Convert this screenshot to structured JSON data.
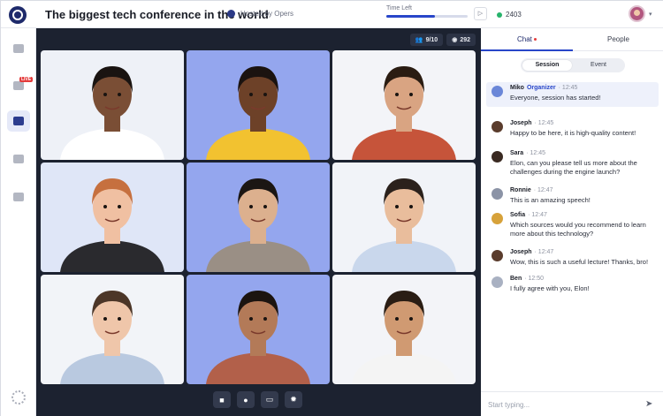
{
  "header": {
    "title": "The biggest tech conference in the world",
    "hosted_by": "Hosted by Opers",
    "time_left_label": "Time Left",
    "time_left_fraction": 0.6,
    "online_count": "2403"
  },
  "sidebar": {
    "items": [
      {
        "icon": "home-icon"
      },
      {
        "icon": "live-video-icon",
        "badge": "LIVE"
      },
      {
        "icon": "people-group-icon",
        "active": true
      },
      {
        "icon": "handshake-icon"
      },
      {
        "icon": "booth-icon"
      }
    ]
  },
  "stage": {
    "participants_count": "9/10",
    "viewers_count": "292",
    "tiles": [
      {
        "bg": "#eef1f7",
        "skin": "#7a4e35",
        "hair": "#1a1411",
        "shirt": "#ffffff"
      },
      {
        "bg": "#94a6ee",
        "skin": "#6d4128",
        "hair": "#1b1310",
        "shirt": "#f2c230"
      },
      {
        "bg": "#f3f4f8",
        "skin": "#d9a482",
        "hair": "#2a1c12",
        "shirt": "#c6543a"
      },
      {
        "bg": "#dfe6f7",
        "skin": "#f0c0a2",
        "hair": "#c6703f",
        "shirt": "#2a2a2e"
      },
      {
        "bg": "#94a6ee",
        "skin": "#dcb08e",
        "hair": "#1b1613",
        "shirt": "#9a8f85"
      },
      {
        "bg": "#f1f3f8",
        "skin": "#e9bd9c",
        "hair": "#2b211c",
        "shirt": "#c9d7ec"
      },
      {
        "bg": "#f2f4f8",
        "skin": "#efc6aa",
        "hair": "#4c3628",
        "shirt": "#b9c9e0"
      },
      {
        "bg": "#94a6ee",
        "skin": "#b37a58",
        "hair": "#1c1410",
        "shirt": "#b2604a"
      },
      {
        "bg": "#f3f4f8",
        "skin": "#d09a72",
        "hair": "#2a1d14",
        "shirt": "#f4f4f4"
      }
    ]
  },
  "chat": {
    "tab_chat": "Chat",
    "tab_people": "People",
    "seg_session": "Session",
    "seg_event": "Event",
    "input_placeholder": "Start typing...",
    "messages": [
      {
        "name": "Miko",
        "role": "Organizer",
        "time": "12:45",
        "text": "Everyone, session has started!",
        "avatar": "#6b87d8",
        "highlight": true
      },
      {
        "name": "Joseph",
        "role": "",
        "time": "12:45",
        "text": "Happy to be here, it is high-quality content!",
        "avatar": "#5a3c2c",
        "highlight": false
      },
      {
        "name": "Sara",
        "role": "",
        "time": "12:45",
        "text": "Elon, can you please tell us more about the challenges during the engine launch?",
        "avatar": "#3a2a22",
        "highlight": false
      },
      {
        "name": "Ronnie",
        "role": "",
        "time": "12:47",
        "text": "This is an amazing speech!",
        "avatar": "#8b93a6",
        "highlight": false
      },
      {
        "name": "Sofia",
        "role": "",
        "time": "12:47",
        "text": "Which sources would you recommend to learn more about this technology?",
        "avatar": "#d7a23a",
        "highlight": false
      },
      {
        "name": "Joseph",
        "role": "",
        "time": "12:47",
        "text": "Wow, this is such a useful lecture! Thanks, bro!",
        "avatar": "#5a3c2c",
        "highlight": false
      },
      {
        "name": "Ben",
        "role": "",
        "time": "12:50",
        "text": "I fully agree with you, Elon!",
        "avatar": "#a9b1c2",
        "highlight": false
      }
    ]
  }
}
